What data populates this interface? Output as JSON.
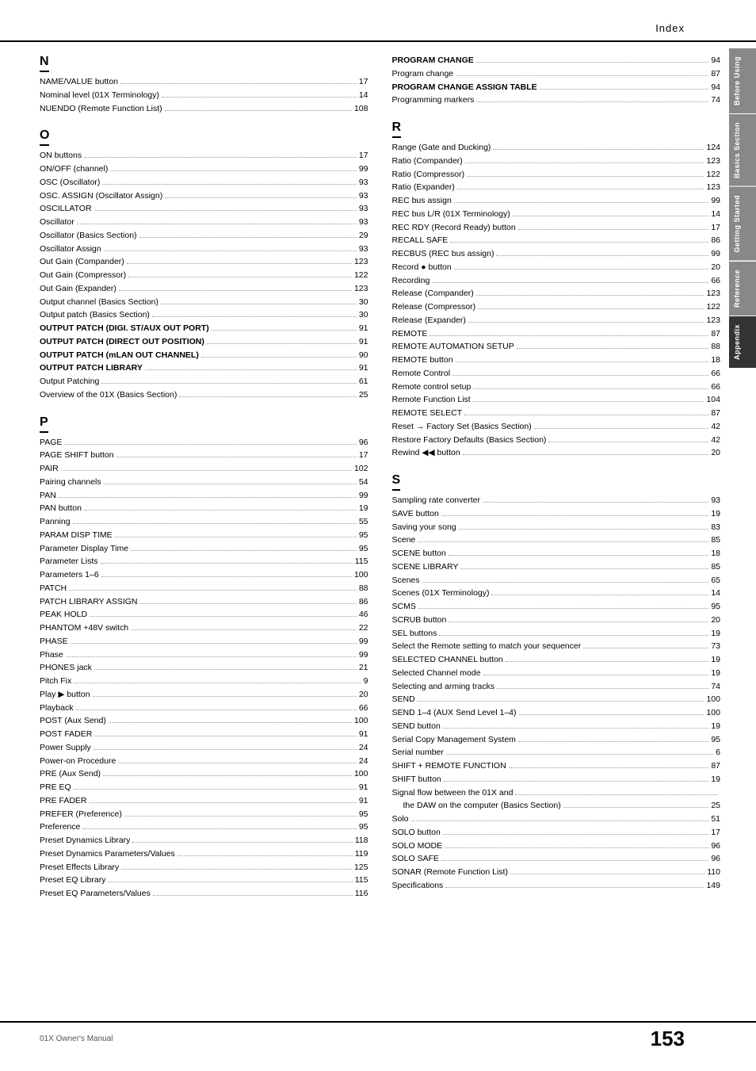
{
  "header": {
    "title": "Index"
  },
  "footer": {
    "manual": "01X  Owner's Manual",
    "page_num": "153"
  },
  "right_tabs": [
    {
      "label": "Before Using",
      "active": false
    },
    {
      "label": "Basics Section",
      "active": false
    },
    {
      "label": "Getting Started",
      "active": false
    },
    {
      "label": "Reference",
      "active": false
    },
    {
      "label": "Appendix",
      "active": true
    }
  ],
  "sections": {
    "left": [
      {
        "letter": "N",
        "entries": [
          {
            "text": "NAME/VALUE button",
            "page": "17"
          },
          {
            "text": "Nominal level (01X Terminology)",
            "page": "14"
          },
          {
            "text": "NUENDO (Remote Function List)",
            "page": "108"
          }
        ]
      },
      {
        "letter": "O",
        "entries": [
          {
            "text": "ON buttons",
            "page": "17"
          },
          {
            "text": "ON/OFF (channel)",
            "page": "99"
          },
          {
            "text": "OSC (Oscillator)",
            "page": "93"
          },
          {
            "text": "OSC. ASSIGN (Oscillator Assign)",
            "page": "93"
          },
          {
            "text": "OSCILLATOR",
            "page": "93"
          },
          {
            "text": "Oscillator",
            "page": "93"
          },
          {
            "text": "Oscillator (Basics Section)",
            "page": "29"
          },
          {
            "text": "Oscillator Assign",
            "page": "93"
          },
          {
            "text": "Out Gain (Compander)",
            "page": "123"
          },
          {
            "text": "Out Gain (Compressor)",
            "page": "122"
          },
          {
            "text": "Out Gain (Expander)",
            "page": "123"
          },
          {
            "text": "Output channel (Basics Section)",
            "page": "30"
          },
          {
            "text": "Output patch (Basics Section)",
            "page": "30"
          },
          {
            "text": "OUTPUT PATCH (DIGI. ST/AUX OUT PORT)",
            "page": "91",
            "bold": true
          },
          {
            "text": "OUTPUT PATCH (DIRECT OUT POSITION)",
            "page": "91",
            "bold": true
          },
          {
            "text": "OUTPUT PATCH (mLAN OUT CHANNEL)",
            "page": "90",
            "bold": true
          },
          {
            "text": "OUTPUT PATCH LIBRARY",
            "page": "91",
            "bold": true
          },
          {
            "text": "Output Patching",
            "page": "61"
          },
          {
            "text": "Overview of the 01X (Basics Section)",
            "page": "25"
          }
        ]
      },
      {
        "letter": "P",
        "entries": [
          {
            "text": "PAGE",
            "page": "96"
          },
          {
            "text": "PAGE SHIFT button",
            "page": "17"
          },
          {
            "text": "PAIR",
            "page": "102"
          },
          {
            "text": "Pairing channels",
            "page": "54"
          },
          {
            "text": "PAN",
            "page": "99"
          },
          {
            "text": "PAN button",
            "page": "19"
          },
          {
            "text": "Panning",
            "page": "55"
          },
          {
            "text": "PARAM DISP TIME",
            "page": "95"
          },
          {
            "text": "Parameter Display Time",
            "page": "95"
          },
          {
            "text": "Parameter Lists",
            "page": "115"
          },
          {
            "text": "Parameters 1–6",
            "page": "100"
          },
          {
            "text": "PATCH",
            "page": "88"
          },
          {
            "text": "PATCH LIBRARY ASSIGN",
            "page": "86"
          },
          {
            "text": "PEAK HOLD",
            "page": "46"
          },
          {
            "text": "PHANTOM +48V switch",
            "page": "22"
          },
          {
            "text": "PHASE",
            "page": "99"
          },
          {
            "text": "Phase",
            "page": "99"
          },
          {
            "text": "PHONES jack",
            "page": "21"
          },
          {
            "text": "Pitch Fix",
            "page": "9"
          },
          {
            "text": "Play ▶ button",
            "page": "20"
          },
          {
            "text": "Playback",
            "page": "66"
          },
          {
            "text": "POST (Aux Send)",
            "page": "100"
          },
          {
            "text": "POST FADER",
            "page": "91"
          },
          {
            "text": "Power Supply",
            "page": "24"
          },
          {
            "text": "Power-on Procedure",
            "page": "24"
          },
          {
            "text": "PRE (Aux Send)",
            "page": "100"
          },
          {
            "text": "PRE EQ",
            "page": "91"
          },
          {
            "text": "PRE FADER",
            "page": "91"
          },
          {
            "text": "PREFER (Preference)",
            "page": "95"
          },
          {
            "text": "Preference",
            "page": "95"
          },
          {
            "text": "Preset Dynamics Library",
            "page": "118"
          },
          {
            "text": "Preset Dynamics Parameters/Values",
            "page": "119"
          },
          {
            "text": "Preset Effects Library",
            "page": "125"
          },
          {
            "text": "Preset EQ Library",
            "page": "115"
          },
          {
            "text": "Preset EQ Parameters/Values",
            "page": "116"
          }
        ]
      }
    ],
    "right": [
      {
        "letter": "P_continued",
        "entries": [
          {
            "text": "PROGRAM CHANGE",
            "page": "94",
            "bold": true
          },
          {
            "text": "Program change",
            "page": "87"
          },
          {
            "text": "PROGRAM CHANGE ASSIGN TABLE",
            "page": "94",
            "bold": true
          },
          {
            "text": "Programming markers",
            "page": "74"
          }
        ]
      },
      {
        "letter": "R",
        "entries": [
          {
            "text": "Range (Gate and Ducking)",
            "page": "124"
          },
          {
            "text": "Ratio (Compander)",
            "page": "123"
          },
          {
            "text": "Ratio (Compressor)",
            "page": "122"
          },
          {
            "text": "Ratio (Expander)",
            "page": "123"
          },
          {
            "text": "REC bus assign",
            "page": "99"
          },
          {
            "text": "REC bus L/R (01X Terminology)",
            "page": "14"
          },
          {
            "text": "REC RDY (Record Ready) button",
            "page": "17"
          },
          {
            "text": "RECALL SAFE",
            "page": "86"
          },
          {
            "text": "RECBUS (REC bus assign)",
            "page": "99"
          },
          {
            "text": "Record ● button",
            "page": "20"
          },
          {
            "text": "Recording",
            "page": "66"
          },
          {
            "text": "Release (Compander)",
            "page": "123"
          },
          {
            "text": "Release (Compressor)",
            "page": "122"
          },
          {
            "text": "Release (Expander)",
            "page": "123"
          },
          {
            "text": "REMOTE",
            "page": "87"
          },
          {
            "text": "REMOTE AUTOMATION SETUP",
            "page": "88"
          },
          {
            "text": "REMOTE button",
            "page": "18"
          },
          {
            "text": "Remote Control",
            "page": "66"
          },
          {
            "text": "Remote control setup",
            "page": "66"
          },
          {
            "text": "Remote Function List",
            "page": "104"
          },
          {
            "text": "REMOTE SELECT",
            "page": "87"
          },
          {
            "text": "Reset → Factory Set (Basics Section)",
            "page": "42"
          },
          {
            "text": "Restore Factory Defaults (Basics Section)",
            "page": "42"
          },
          {
            "text": "Rewind ◀◀ button",
            "page": "20"
          }
        ]
      },
      {
        "letter": "S",
        "entries": [
          {
            "text": "Sampling rate converter",
            "page": "93"
          },
          {
            "text": "SAVE button",
            "page": "19"
          },
          {
            "text": "Saving your song",
            "page": "83"
          },
          {
            "text": "Scene",
            "page": "85"
          },
          {
            "text": "SCENE button",
            "page": "18"
          },
          {
            "text": "SCENE LIBRARY",
            "page": "85"
          },
          {
            "text": "Scenes",
            "page": "65"
          },
          {
            "text": "Scenes (01X Terminology)",
            "page": "14"
          },
          {
            "text": "SCMS",
            "page": "95"
          },
          {
            "text": "SCRUB button",
            "page": "20"
          },
          {
            "text": "SEL buttons",
            "page": "19"
          },
          {
            "text": "Select the Remote setting to match your sequencer",
            "page": "73"
          },
          {
            "text": "SELECTED CHANNEL button",
            "page": "19"
          },
          {
            "text": "Selected Channel mode",
            "page": "19"
          },
          {
            "text": "Selecting and arming tracks",
            "page": "74"
          },
          {
            "text": "SEND",
            "page": "100"
          },
          {
            "text": "SEND 1–4 (AUX Send Level 1–4)",
            "page": "100"
          },
          {
            "text": "SEND button",
            "page": "19"
          },
          {
            "text": "Serial Copy Management System",
            "page": "95"
          },
          {
            "text": "Serial number",
            "page": "6"
          },
          {
            "text": "SHIFT + REMOTE FUNCTION",
            "page": "87"
          },
          {
            "text": "SHIFT button",
            "page": "19"
          },
          {
            "text": "Signal flow between the 01X and",
            "page": "",
            "continuation": true
          },
          {
            "text": "  the DAW on the computer (Basics Section)",
            "page": "25",
            "indent": true
          },
          {
            "text": "Solo",
            "page": "51"
          },
          {
            "text": "SOLO button",
            "page": "17"
          },
          {
            "text": "SOLO MODE",
            "page": "96"
          },
          {
            "text": "SOLO SAFE",
            "page": "96"
          },
          {
            "text": "SONAR (Remote Function List)",
            "page": "110"
          },
          {
            "text": "Specifications",
            "page": "149"
          }
        ]
      }
    ]
  }
}
